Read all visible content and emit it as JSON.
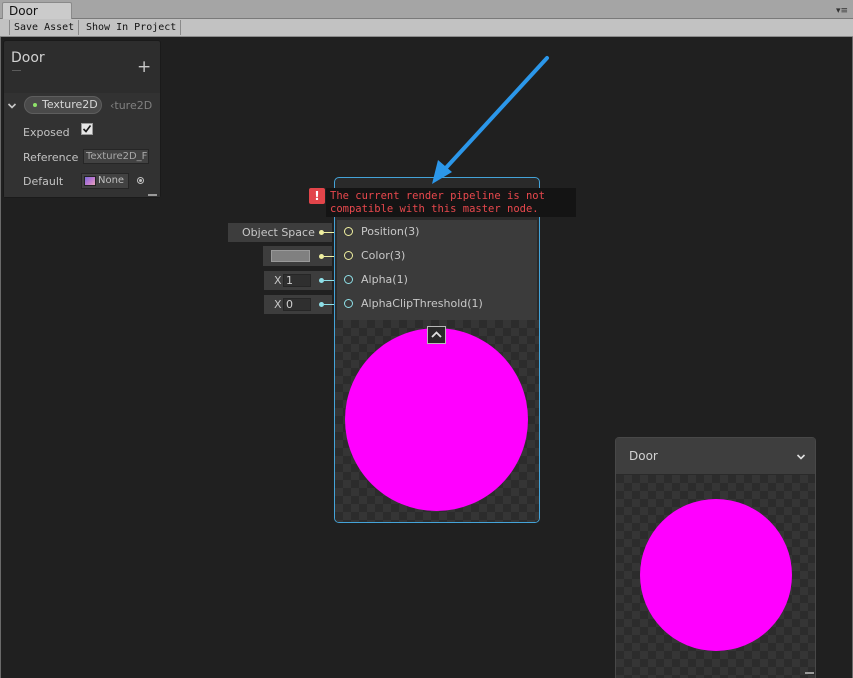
{
  "window": {
    "tab_title": "Door",
    "menu_icon": "▾≡"
  },
  "toolbar": {
    "save_asset": "Save Asset",
    "show_in_project": "Show In Project"
  },
  "blackboard": {
    "title": "Door",
    "add_icon": "+",
    "property": {
      "name": "Texture2D",
      "type_label": "‹ture2D",
      "exposed_label": "Exposed",
      "exposed_checked": true,
      "reference_label": "Reference",
      "reference_value": "Texture2D_F",
      "default_label": "Default",
      "default_value": "None"
    }
  },
  "master_node": {
    "error_icon": "!",
    "error_line1": "The current render pipeline is not",
    "error_line2": "compatible with this master node.",
    "ports": [
      {
        "label": "Position(3)",
        "color": "#f0f0a0"
      },
      {
        "label": "Color(3)",
        "color": "#f0f0a0"
      },
      {
        "label": "Alpha(1)",
        "color": "#8fe0e8"
      },
      {
        "label": "AlphaClipThreshold(1)",
        "color": "#8fe0e8"
      }
    ],
    "inputs": {
      "position_space": "Object Space",
      "alpha_axis": "X",
      "alpha_value": "1",
      "clip_axis": "X",
      "clip_value": "0"
    }
  },
  "preview_window": {
    "title": "Door"
  },
  "colors": {
    "accent_border": "#44a3d8",
    "preview_magenta": "#ff00ff",
    "error_red": "#e2454a",
    "arrow_blue": "#2b97ea"
  }
}
